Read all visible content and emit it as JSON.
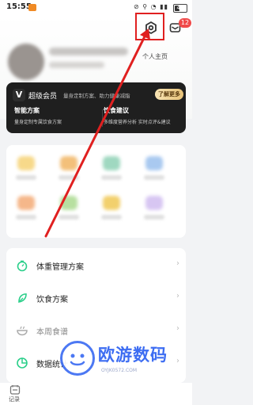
{
  "status_bar": {
    "time": "15:55",
    "icons": "⊘ ⚲ ◔ ▮▮",
    "battery": "40",
    "battery_level": 0.4
  },
  "header": {
    "message_badge": "12",
    "profile_link": "个人主页"
  },
  "member_card": {
    "title": "超级会员",
    "desc": "量身定制方案、助力健康减脂",
    "button": "了解更多",
    "features": [
      {
        "title": "智能方案",
        "desc": "量身定制专属饮食方案"
      },
      {
        "title": "饮食建议",
        "desc": "多维度营养分析 实时点评&建议"
      }
    ]
  },
  "menu": [
    {
      "label": "体重管理方案",
      "icon": "scale-icon",
      "color": "#2bcf8a"
    },
    {
      "label": "饮食方案",
      "icon": "leaf-icon",
      "color": "#2bcf8a"
    },
    {
      "label": "本周食谱",
      "icon": "bowl-icon",
      "color": "#aaaaaa"
    },
    {
      "label": "数据统计",
      "icon": "pie-icon",
      "color": "#2bcf8a"
    }
  ],
  "bottom_nav": {
    "record_label": "记录"
  },
  "watermark": {
    "title": "欧游数码",
    "url": "OYJK0572.COM"
  },
  "colors": {
    "accent": "#2bcf8a",
    "annotation": "#e02020",
    "watermark": "#3d6df2"
  }
}
